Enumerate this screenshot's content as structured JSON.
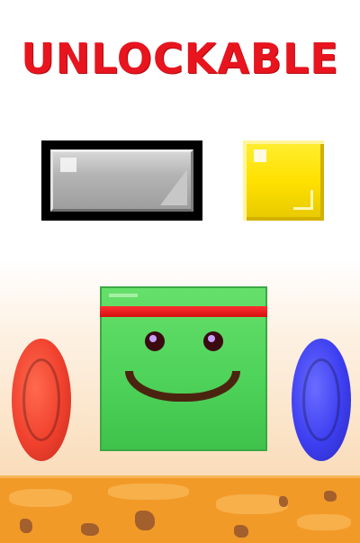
{
  "title": "UNLOCKABLE",
  "unlockables": [
    {
      "name": "gray-block",
      "color": "#b4b4b4"
    },
    {
      "name": "yellow-block",
      "color": "#ffe100"
    }
  ],
  "character": {
    "color": "#4fd35a",
    "headband_color": "#e8141e"
  },
  "portals": [
    {
      "name": "red-portal",
      "color": "#f0402e"
    },
    {
      "name": "blue-portal",
      "color": "#3d3ef0"
    }
  ],
  "ground": {
    "color": "#f29a28"
  }
}
